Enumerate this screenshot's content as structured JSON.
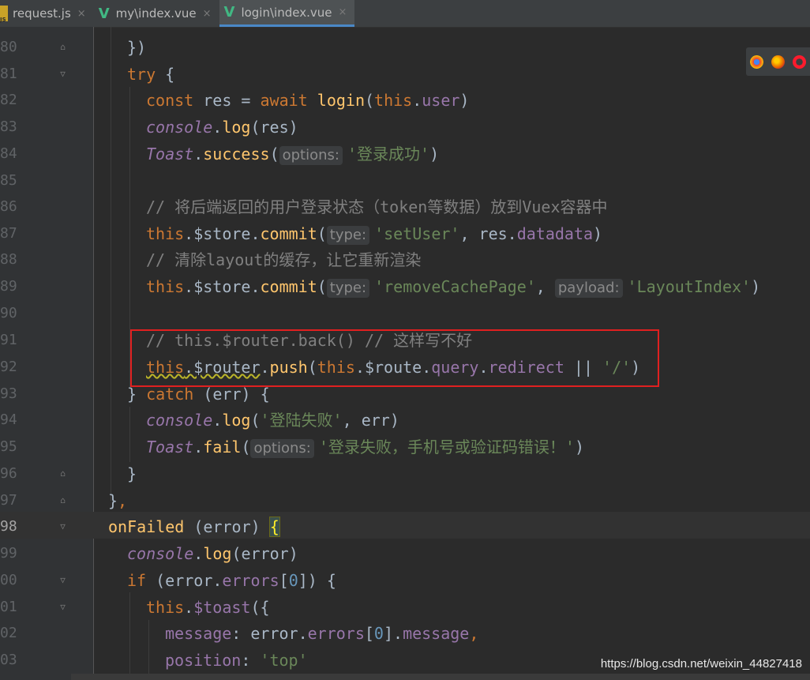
{
  "tabs": [
    {
      "label": "request.js",
      "icon": "js-file-icon",
      "active": false
    },
    {
      "label": "my\\index.vue",
      "icon": "vue-file-icon",
      "active": false
    },
    {
      "label": "login\\index.vue",
      "icon": "vue-file-icon",
      "active": true
    }
  ],
  "tab_close_glyph": "×",
  "lines": [
    {
      "num": "80"
    },
    {
      "num": "81"
    },
    {
      "num": "82"
    },
    {
      "num": "83"
    },
    {
      "num": "84"
    },
    {
      "num": "85"
    },
    {
      "num": "86"
    },
    {
      "num": "87"
    },
    {
      "num": "88"
    },
    {
      "num": "89"
    },
    {
      "num": "90"
    },
    {
      "num": "91"
    },
    {
      "num": "92"
    },
    {
      "num": "93"
    },
    {
      "num": "94"
    },
    {
      "num": "95"
    },
    {
      "num": "96"
    },
    {
      "num": "97"
    },
    {
      "num": "98"
    },
    {
      "num": "99"
    },
    {
      "num": "00"
    },
    {
      "num": "01"
    },
    {
      "num": "02"
    },
    {
      "num": "03"
    }
  ],
  "code": {
    "l80": "})",
    "l81_kw": "try",
    "l81_rest": " {",
    "l82": {
      "const": "const",
      "var": " res = ",
      "await": "await",
      "fn": " login",
      "open": "(",
      "this": "this",
      "dot": ".",
      "prop": "user",
      "close": ")"
    },
    "l83": {
      "obj": "console",
      "dot": ".",
      "fn": "log",
      "args": "(res)"
    },
    "l84": {
      "obj": "Toast",
      "dot": ".",
      "fn": "success",
      "open": "(",
      "hint": "options:",
      "str": "'登录成功'",
      "close": ")"
    },
    "l86": "// 将后端返回的用户登录状态（token等数据）放到Vuex容器中",
    "l87": {
      "this": "this",
      "mid": ".$store.",
      "fn": "commit",
      "open": "(",
      "hint": "type:",
      "str": "'setUser'",
      "comma": ", res.",
      "p1": "data",
      ".": ".",
      "p2": "data",
      "close": ")"
    },
    "l88": "// 清除layout的缓存，让它重新渲染",
    "l89": {
      "this": "this",
      "mid": ".$store.",
      "fn": "commit",
      "open": "(",
      "hint": "type:",
      "str": "'removeCachePage'",
      "comma": ", ",
      "hint2": "payload:",
      "str2": "'LayoutIndex'",
      "close": ")"
    },
    "l91": "// this.$router.back() // 这样写不好",
    "l92": {
      "this": "this",
      "router": ".$router",
      "dot": ".",
      "fn": "push",
      "open": "(",
      "this2": "this",
      "route": ".$route.",
      "p1": "query",
      "dot2": ".",
      "p2": "redirect",
      "or": " || ",
      "str": "'/'",
      "close": ")"
    },
    "l93": {
      "brace": "} ",
      "kw": "catch",
      "rest": " (err) {"
    },
    "l94": {
      "obj": "console",
      "dot": ".",
      "fn": "log",
      "open": "(",
      "str": "'登陆失败'",
      "rest": ", err)"
    },
    "l95": {
      "obj": "Toast",
      "dot": ".",
      "fn": "fail",
      "open": "(",
      "hint": "options:",
      "str": "'登录失败，手机号或验证码错误！'",
      "close": ")"
    },
    "l96": "}",
    "l97": {
      "brace": "}",
      "comma": ","
    },
    "l98": {
      "fn": "onFailed",
      "rest": " (error) ",
      "brace": "{"
    },
    "l99": {
      "obj": "console",
      "dot": ".",
      "fn": "log",
      "args": "(error)"
    },
    "l00": {
      "kw": "if",
      "a": " (error.",
      "p": "errors",
      "b": "[",
      "n": "0",
      "c": "]) {"
    },
    "l01": {
      "this": "this",
      "dot": ".",
      "p": "$toast",
      "rest": "({"
    },
    "l02": {
      "p": "message",
      "a": ": error.",
      "p2": "errors",
      "b": "[",
      "n": "0",
      "c": "].",
      "p3": "message",
      "d": ","
    },
    "l03": {
      "p": "position",
      "a": ": ",
      "str": "'top'"
    }
  },
  "browser_icons": [
    "chrome-icon",
    "firefox-icon",
    "opera-icon"
  ],
  "watermark": "https://blog.csdn.net/weixin_44827418"
}
